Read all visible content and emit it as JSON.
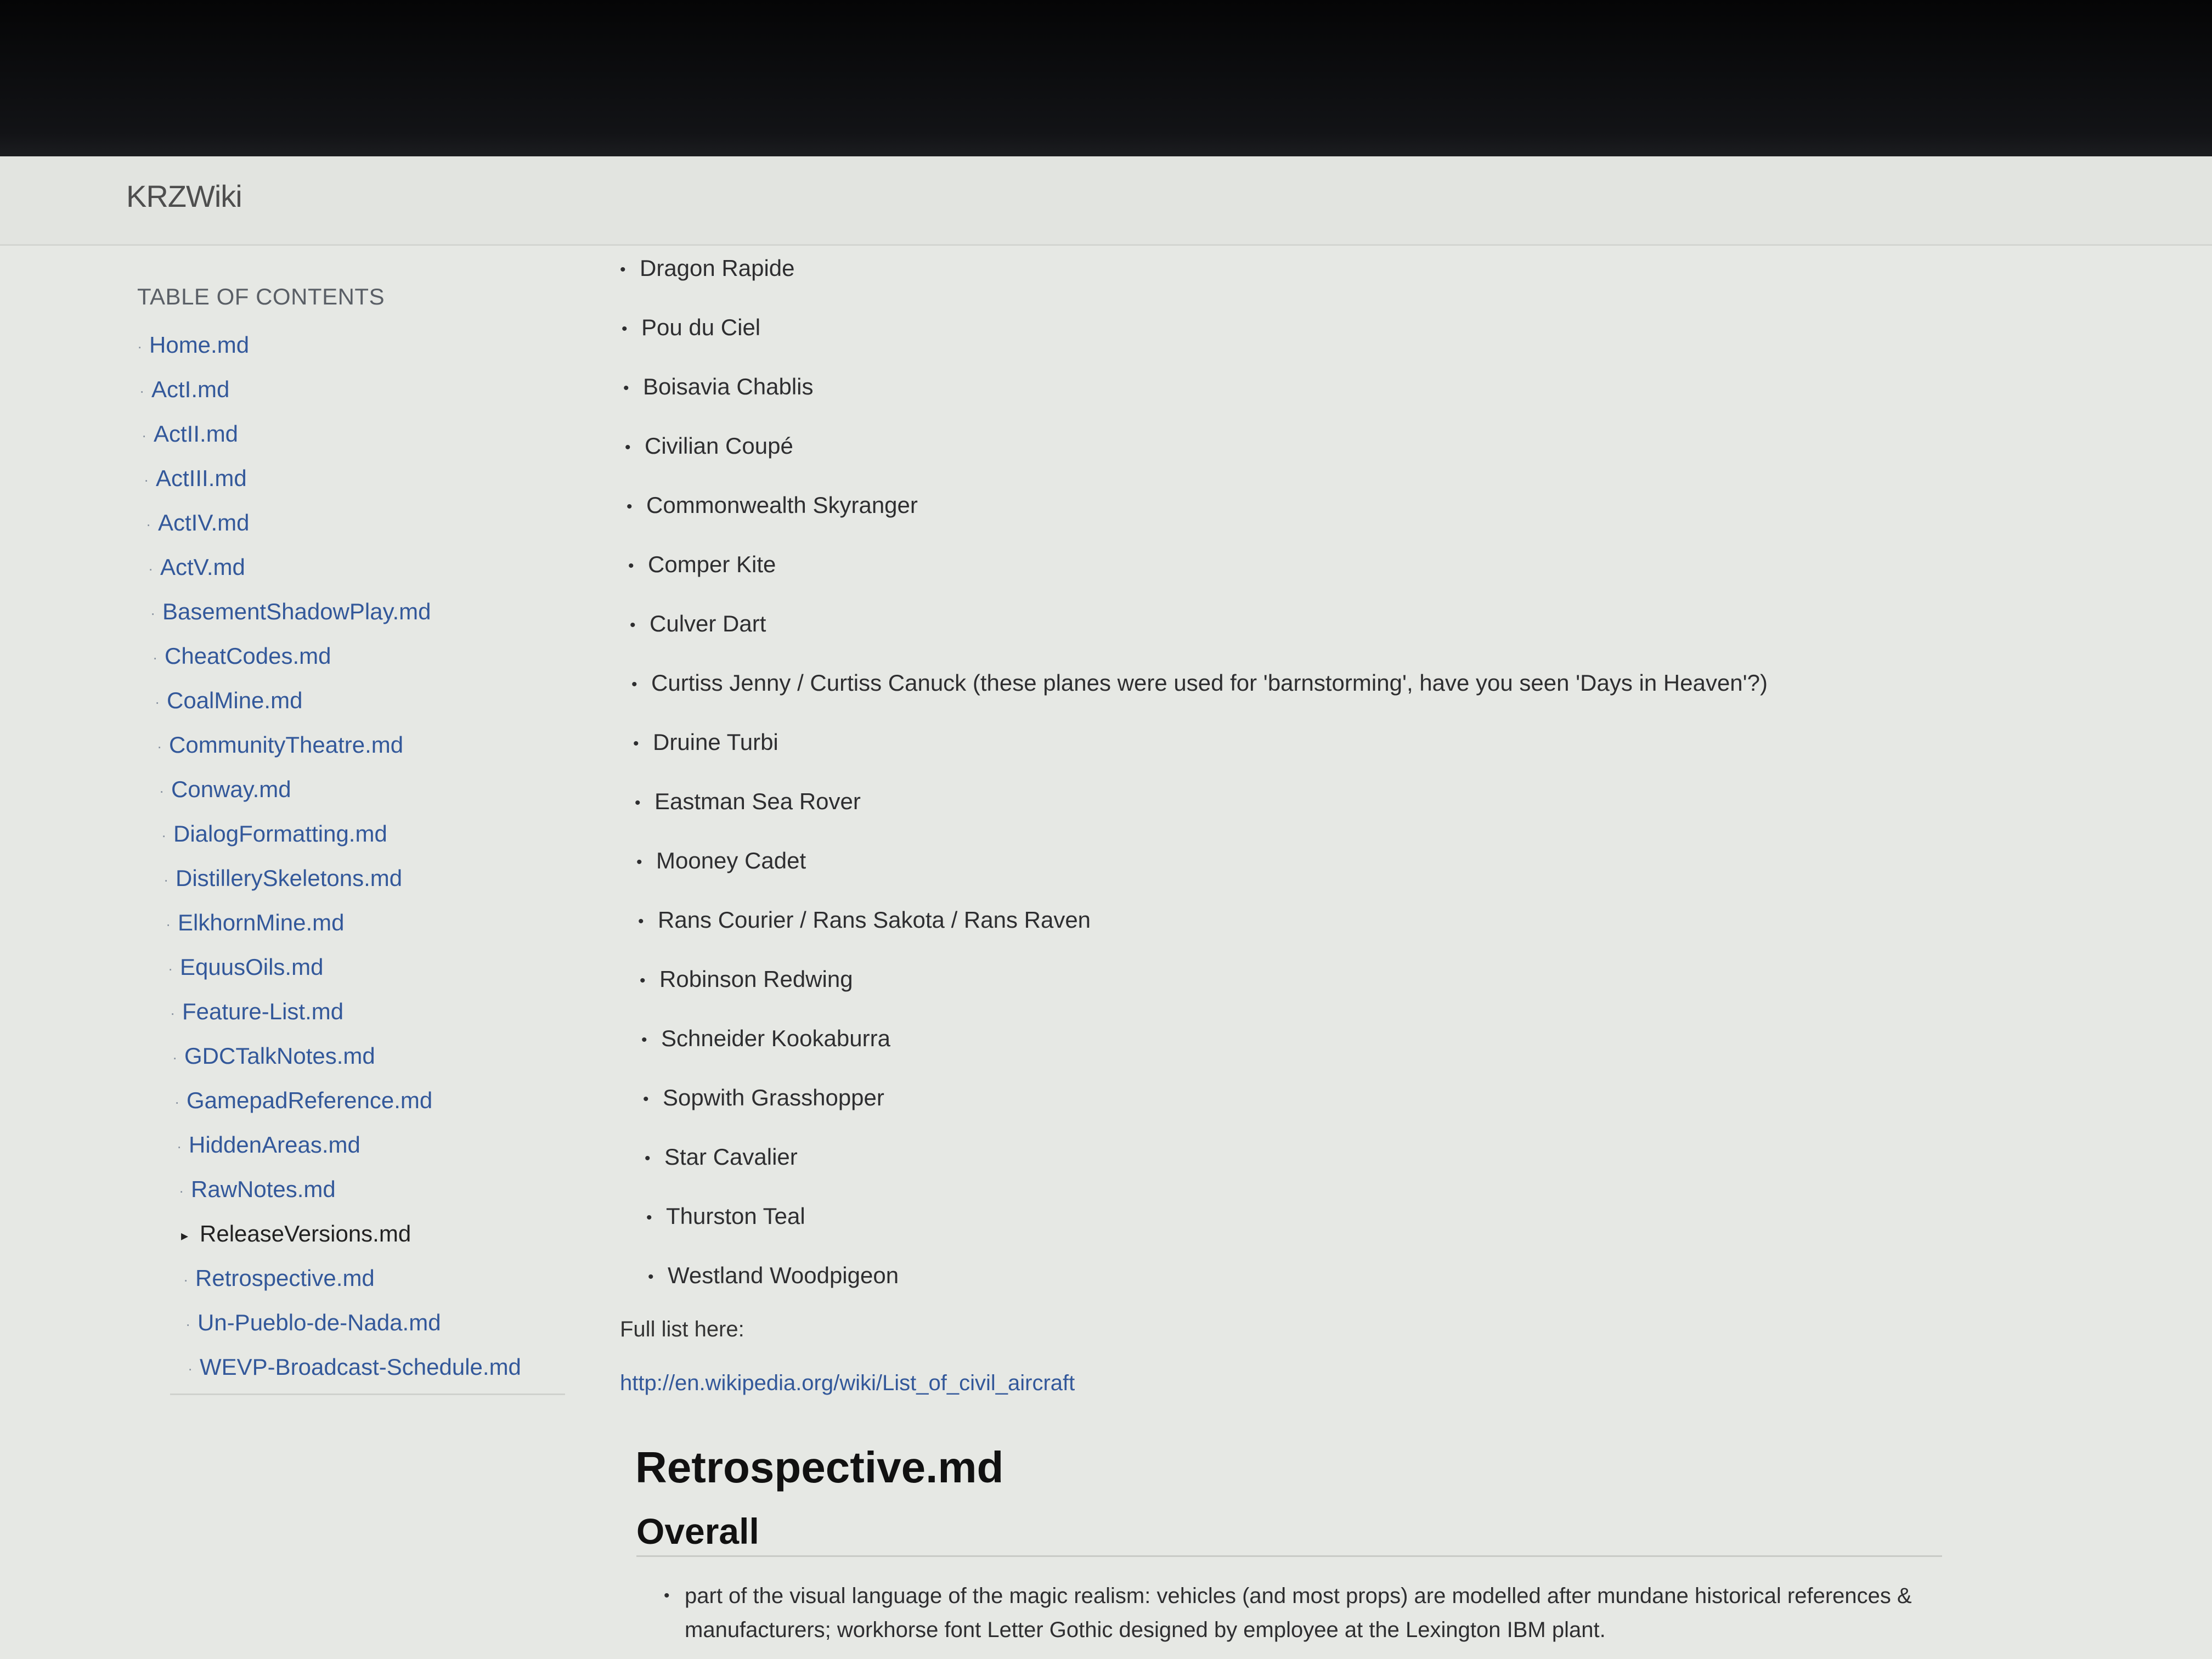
{
  "header": {
    "brand": "KRZWiki"
  },
  "toc": {
    "heading": "TABLE OF CONTENTS",
    "bullet": "·",
    "active_bullet": "▸",
    "items": [
      {
        "label": "Home.md"
      },
      {
        "label": "ActI.md"
      },
      {
        "label": "ActII.md"
      },
      {
        "label": "ActIII.md"
      },
      {
        "label": "ActIV.md"
      },
      {
        "label": "ActV.md"
      },
      {
        "label": "BasementShadowPlay.md"
      },
      {
        "label": "CheatCodes.md"
      },
      {
        "label": "CoalMine.md"
      },
      {
        "label": "CommunityTheatre.md"
      },
      {
        "label": "Conway.md"
      },
      {
        "label": "DialogFormatting.md"
      },
      {
        "label": "DistillerySkeletons.md"
      },
      {
        "label": "ElkhornMine.md"
      },
      {
        "label": "EquusOils.md"
      },
      {
        "label": "Feature-List.md"
      },
      {
        "label": "GDCTalkNotes.md"
      },
      {
        "label": "GamepadReference.md"
      },
      {
        "label": "HiddenAreas.md"
      },
      {
        "label": "RawNotes.md"
      },
      {
        "label": "ReleaseVersions.md",
        "active": true
      },
      {
        "label": "Retrospective.md"
      },
      {
        "label": "Un-Pueblo-de-Nada.md"
      },
      {
        "label": "WEVP-Broadcast-Schedule.md"
      }
    ]
  },
  "content": {
    "bullet": "•",
    "planes": [
      "Dragon Rapide",
      "Pou du Ciel",
      "Boisavia Chablis",
      "Civilian Coupé",
      "Commonwealth Skyranger",
      "Comper Kite",
      "Culver Dart",
      "Curtiss Jenny / Curtiss Canuck (these planes were used for 'barnstorming', have you seen 'Days in Heaven'?)",
      "Druine Turbi",
      "Eastman Sea Rover",
      "Mooney Cadet",
      "Rans Courier / Rans Sakota / Rans Raven",
      "Robinson Redwing",
      "Schneider Kookaburra",
      "Sopwith Grasshopper",
      "Star Cavalier",
      "Thurston Teal",
      "Westland Woodpigeon"
    ],
    "full_list_label": "Full list here:",
    "full_list_link": "http://en.wikipedia.org/wiki/List_of_civil_aircraft",
    "section_title": "Retrospective.md",
    "subsection_title": "Overall",
    "paragraph": "part of the visual language of the magic realism: vehicles (and most props) are modelled after mundane historical references & manufacturers; workhorse font Letter Gothic designed by employee at the Lexington IBM plant."
  }
}
